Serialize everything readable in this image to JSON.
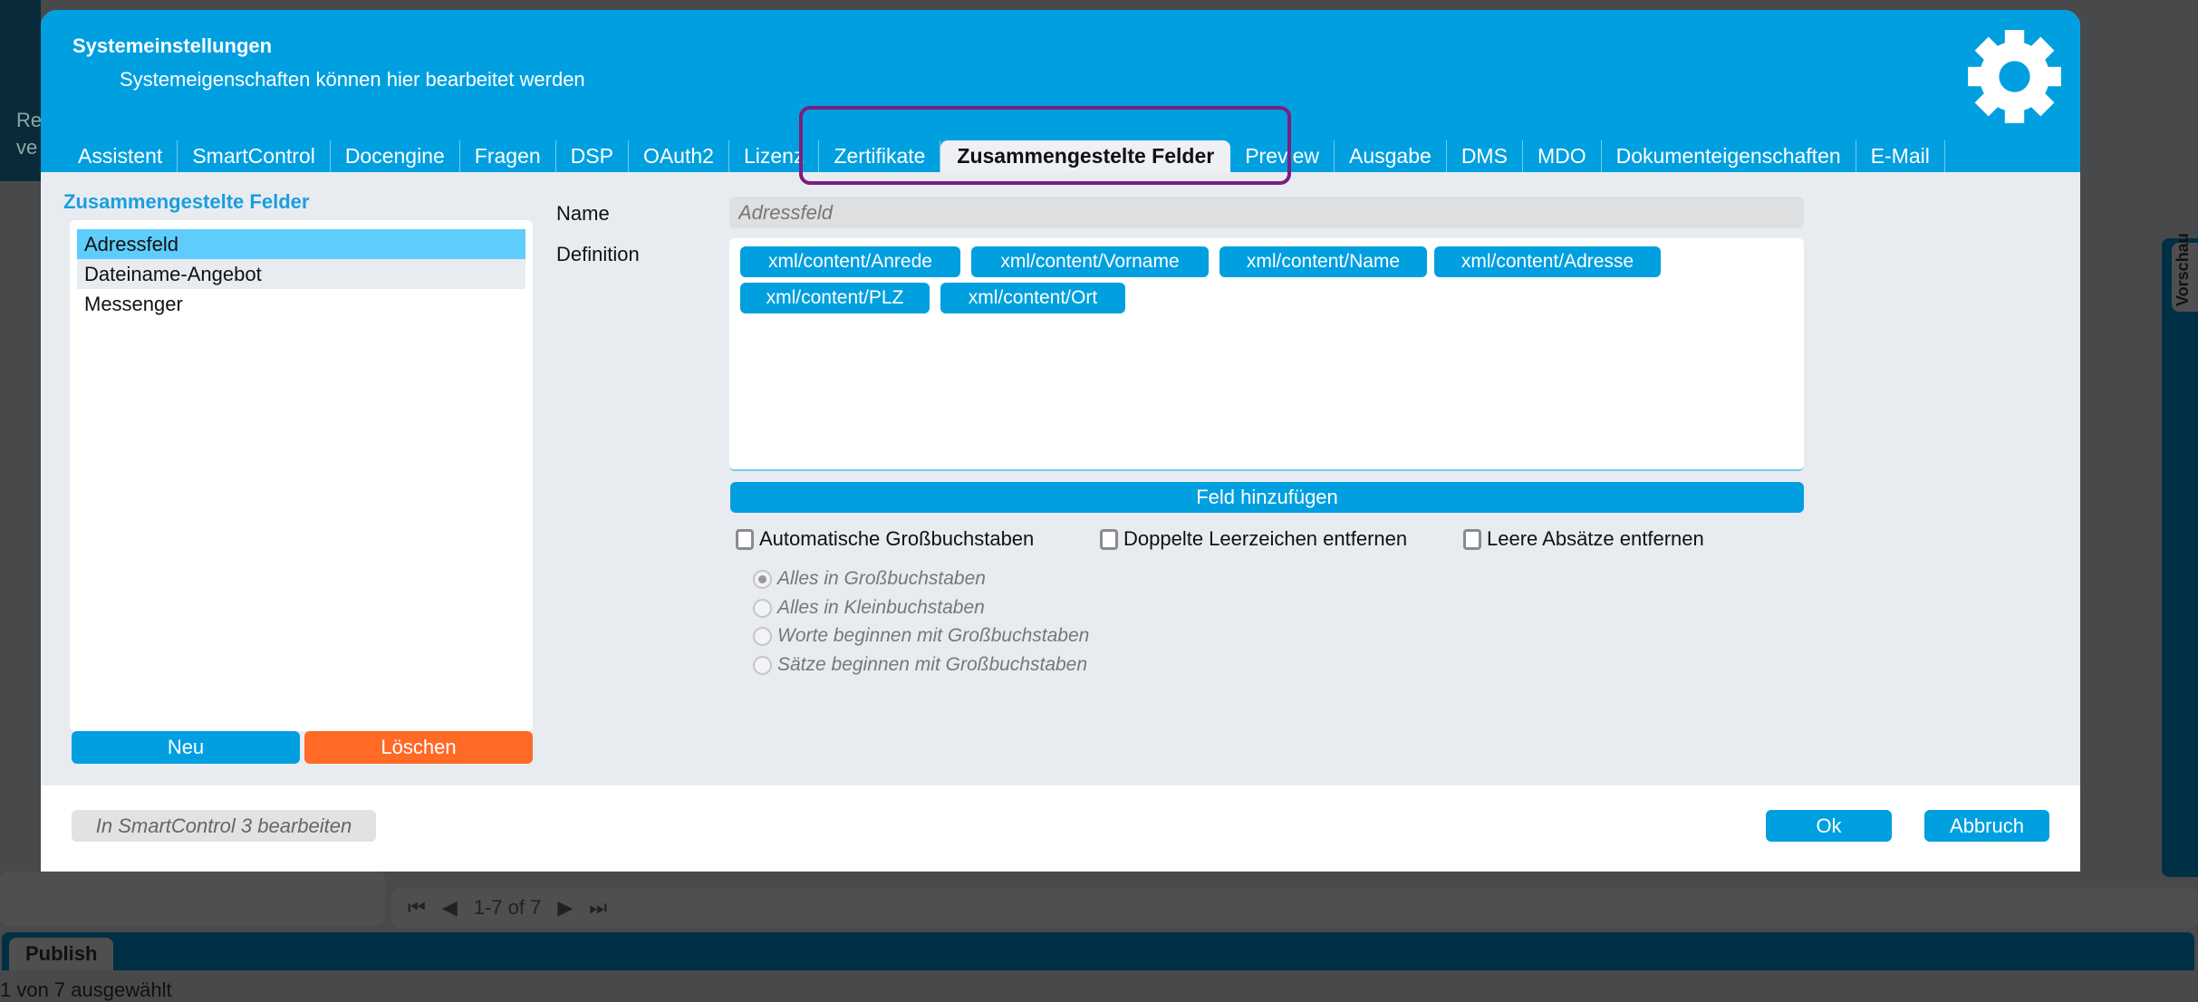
{
  "background": {
    "pager": {
      "text": "1-7 of 7"
    },
    "publish_tab": "Publish",
    "status": "1 von 7 ausgewählt",
    "side_tab": "Vorschau",
    "left_fragment": [
      "Re",
      "ve"
    ]
  },
  "dialog": {
    "title": "Systemeinstellungen",
    "subtitle": "Systemeigenschaften können hier bearbeitet werden",
    "icon": "gear-icon",
    "tabs": [
      "Assistent",
      "SmartControl",
      "Docengine",
      "Fragen",
      "DSP",
      "OAuth2",
      "Lizenz",
      "Zertifikate",
      "Zusammengestelte Felder",
      "Preview",
      "Ausgabe",
      "DMS",
      "MDO",
      "Dokumenteigenschaften",
      "E-Mail"
    ],
    "active_tab": "Zusammengestelte Felder",
    "left": {
      "title": "Zusammengestelte Felder",
      "items": [
        "Adressfeld",
        "Dateiname-Angebot",
        "Messenger"
      ],
      "selected": "Adressfeld",
      "new_label": "Neu",
      "delete_label": "Löschen"
    },
    "form": {
      "name_label": "Name",
      "name_value": "Adressfeld",
      "definition_label": "Definition",
      "chips": [
        "xml/content/Anrede",
        "xml/content/Vorname",
        "xml/content/Name",
        "xml/content/Adresse",
        "xml/content/PLZ",
        "xml/content/Ort"
      ],
      "add_field_label": "Feld hinzufügen",
      "checkboxes": [
        {
          "label": "Automatische Großbuchstaben",
          "checked": false
        },
        {
          "label": "Doppelte Leerzeichen entfernen",
          "checked": false
        },
        {
          "label": "Leere Absätze entfernen",
          "checked": false
        }
      ],
      "radios": [
        {
          "label": "Alles in Großbuchstaben",
          "checked": true
        },
        {
          "label": "Alles in Kleinbuchstaben",
          "checked": false
        },
        {
          "label": "Worte beginnen mit Großbuchstaben",
          "checked": false
        },
        {
          "label": "Sätze beginnen mit Großbuchstaben",
          "checked": false
        }
      ]
    },
    "footer": {
      "smartcontrol_label": "In SmartControl 3 bearbeiten",
      "ok_label": "Ok",
      "cancel_label": "Abbruch"
    }
  },
  "colors": {
    "accent": "#009fe0",
    "delete": "#ff6a26",
    "highlight": "#7a1f80",
    "selected_item": "#5fcdfc"
  }
}
